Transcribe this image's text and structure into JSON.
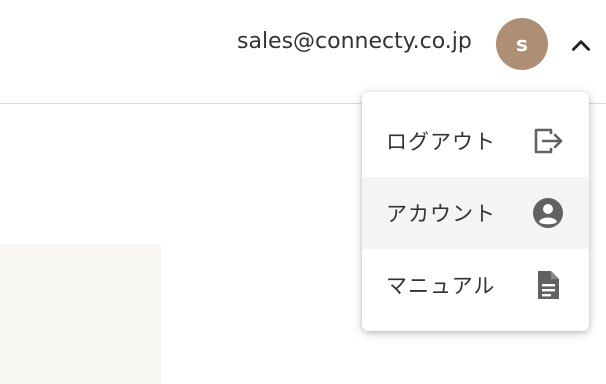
{
  "header": {
    "user_email": "sales@connecty.co.jp",
    "avatar_initial": "s",
    "avatar_color": "#ae8f74",
    "menu_toggle_icon": "chevron-up-icon"
  },
  "user_menu": {
    "items": [
      {
        "label": "ログアウト",
        "icon": "logout-icon"
      },
      {
        "label": "アカウント",
        "icon": "account-circle-icon"
      },
      {
        "label": "マニュアル",
        "icon": "document-icon"
      }
    ]
  },
  "colors": {
    "icon": "#616161",
    "text": "#333333",
    "active_item_bg": "#f4f4f4",
    "panel_bg": "#f7f6f3"
  }
}
